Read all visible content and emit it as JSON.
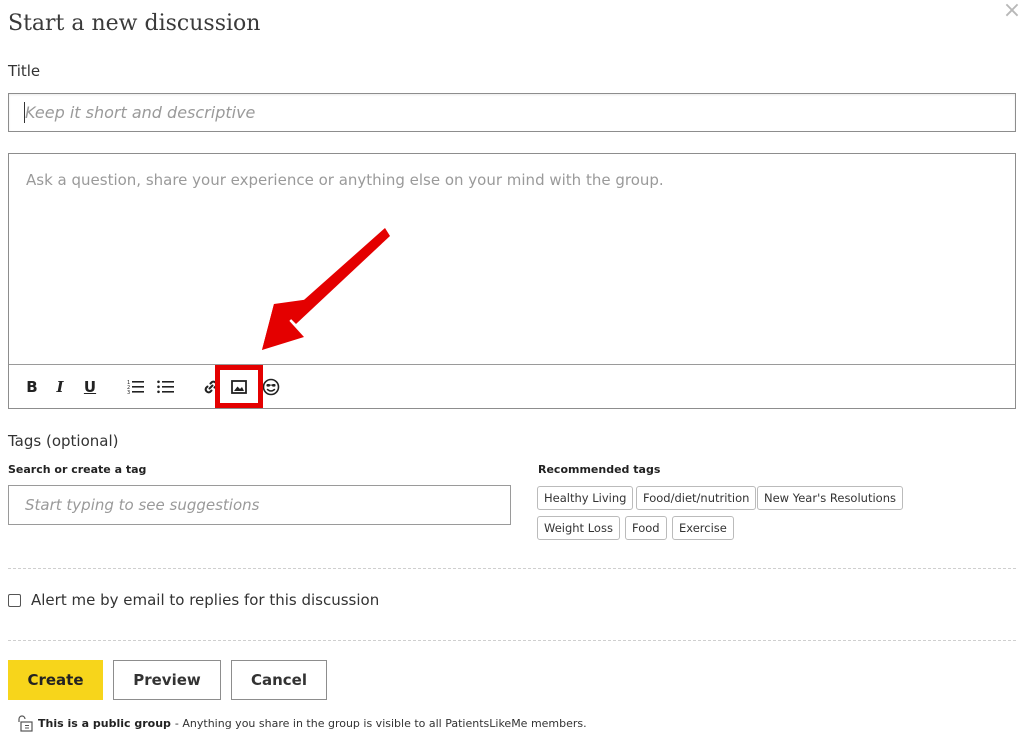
{
  "dialog": {
    "heading": "Start a new discussion",
    "close_glyph": "×"
  },
  "title": {
    "label": "Title",
    "placeholder": "Keep it short and descriptive"
  },
  "editor": {
    "placeholder": "Ask a question, share your experience or anything else on your mind with the group.",
    "toolbar": {
      "bold": "B",
      "italic": "I",
      "underline": "U",
      "icons": [
        "ordered-list-icon",
        "bullet-list-icon",
        "link-icon",
        "image-icon",
        "emoji-icon"
      ]
    }
  },
  "annotation": {
    "highlight_color": "#e40000",
    "target": "image-icon"
  },
  "tags": {
    "label": "Tags (optional)",
    "search_label": "Search or create a tag",
    "search_placeholder": "Start typing to see suggestions",
    "recommended_label": "Recommended tags",
    "recommended": [
      "Healthy Living",
      "Food/diet/nutrition",
      "New Year's Resolutions",
      "Weight Loss",
      "Food",
      "Exercise"
    ]
  },
  "alert": {
    "text": "Alert me by email to replies for this discussion",
    "checked": false
  },
  "buttons": {
    "create": "Create",
    "preview": "Preview",
    "cancel": "Cancel",
    "create_color": "#f7d51b"
  },
  "public_note": {
    "bold": "This is a public group",
    "text": "- Anything you share in the group is visible to all PatientsLikeMe members."
  }
}
